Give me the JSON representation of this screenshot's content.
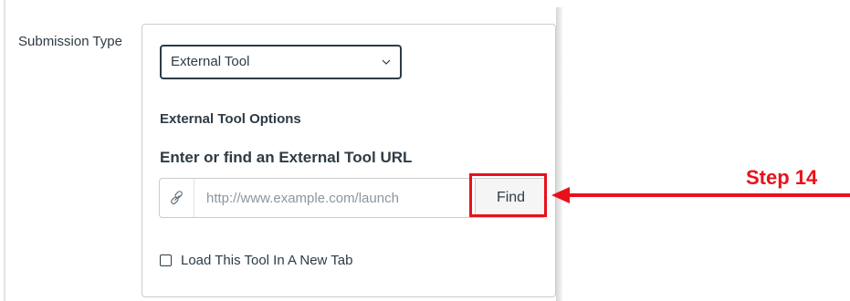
{
  "form": {
    "field_label": "Submission Type",
    "submission_type": {
      "selected": "External Tool",
      "icon": "chevron-down-icon"
    },
    "options_heading": "External Tool Options",
    "url_heading": "Enter or find an External Tool URL",
    "url_input": {
      "placeholder": "http://www.example.com/launch",
      "value": "",
      "icon": "link-icon"
    },
    "find_button_label": "Find",
    "new_tab_checkbox": {
      "label": "Load This Tool In A New Tab",
      "checked": false
    }
  },
  "annotation": {
    "step_label": "Step 14",
    "color": "#e8111b"
  }
}
